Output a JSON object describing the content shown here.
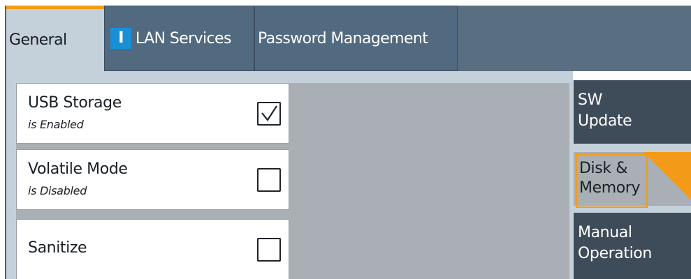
{
  "tabs": [
    {
      "label": "General",
      "active": true
    },
    {
      "label": "LAN Services",
      "badge": "I"
    },
    {
      "label": "Password Management"
    }
  ],
  "settings": [
    {
      "title": "USB Storage",
      "subtitle": "is Enabled",
      "checked": true
    },
    {
      "title": "Volatile Mode",
      "subtitle": "is Disabled",
      "checked": false
    },
    {
      "title": "Sanitize",
      "subtitle": "",
      "checked": false
    }
  ],
  "sidenav": {
    "sw_update": [
      "SW",
      "Update"
    ],
    "disk_memory": [
      "Disk &",
      "Memory"
    ],
    "manual_operation": [
      "Manual",
      "Operation"
    ]
  },
  "colors": {
    "accent": "#f39b18",
    "tab_active_bg": "#c5d1da",
    "tab_bg": "#526a80",
    "nav_bg": "#3e4c5a",
    "info_badge": "#1890d8"
  }
}
